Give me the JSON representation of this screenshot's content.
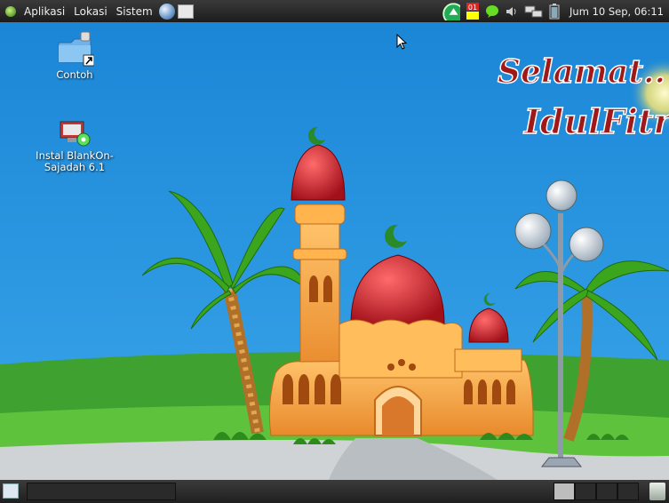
{
  "top_panel": {
    "menu": [
      "Aplikasi",
      "Lokasi",
      "Sistem"
    ],
    "clock": "Jum 10 Sep, 06:11",
    "tray": {
      "battery_icon": "battery-icon",
      "volume_icon": "volume-icon",
      "network_icon": "network-icon",
      "chat_icon": "chat-icon",
      "update_badge": "01"
    }
  },
  "desktop": {
    "icons": [
      {
        "label": "Contoh"
      },
      {
        "label": "Instal BlankOn-Sajadah 6.1"
      }
    ]
  },
  "wallpaper": {
    "greeting_line1": "Selamat..",
    "greeting_line2": "IdulFitri"
  },
  "bottom_panel": {
    "workspaces": [
      true,
      false,
      false,
      false
    ]
  }
}
